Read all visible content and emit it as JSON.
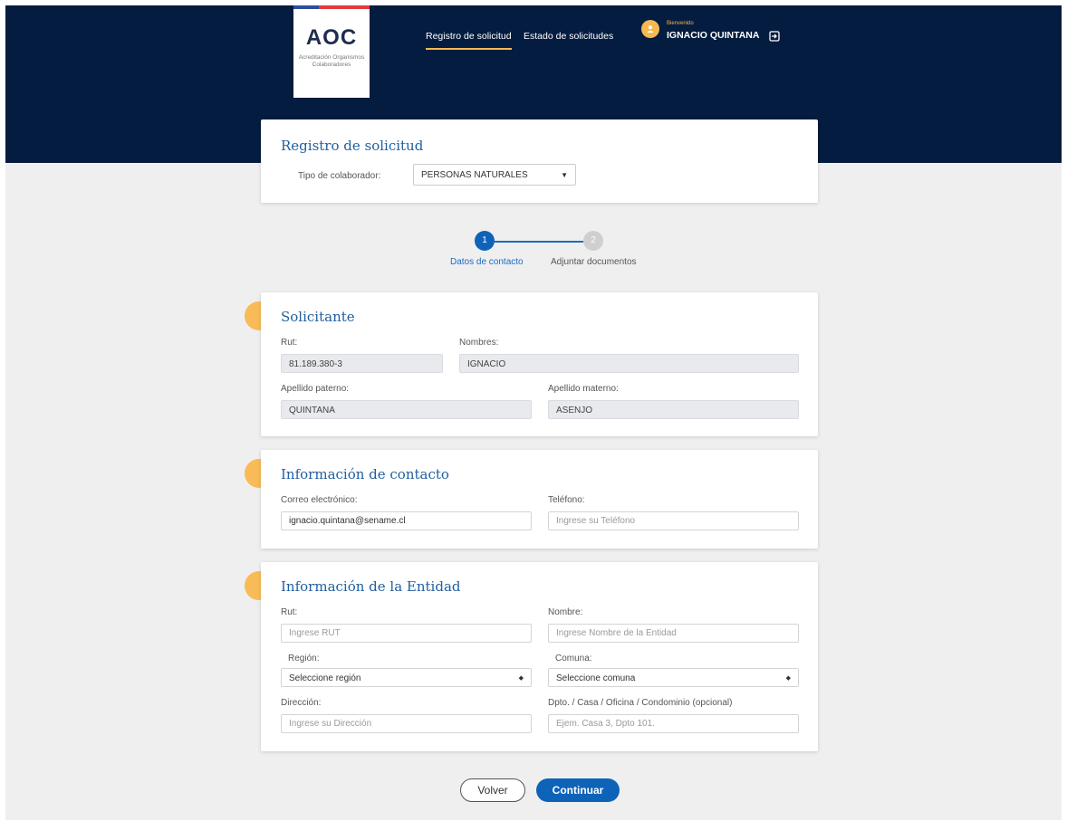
{
  "header": {
    "logo_title": "AOC",
    "logo_subtitle": "Acreditación Organismos Colaboradores",
    "nav": [
      {
        "label": "Registro de solicitud",
        "active": true
      },
      {
        "label": "Estado de solicitudes",
        "active": false
      }
    ],
    "user": {
      "greeting": "Bienvenido",
      "name": "IGNACIO QUINTANA"
    },
    "icons": {
      "avatar": "user-icon",
      "logout": "logout-icon"
    }
  },
  "registro": {
    "title": "Registro de solicitud",
    "tipo_label": "Tipo de colaborador:",
    "tipo_value": "PERSONAS NATURALES"
  },
  "stepper": {
    "steps": [
      {
        "number": "1",
        "label": "Datos de contacto",
        "active": true
      },
      {
        "number": "2",
        "label": "Adjuntar documentos",
        "active": false
      }
    ]
  },
  "solicitante": {
    "title": "Solicitante",
    "rut_label": "Rut:",
    "rut_value": "81.189.380-3",
    "nombres_label": "Nombres:",
    "nombres_value": "IGNACIO",
    "ap_paterno_label": "Apellido paterno:",
    "ap_paterno_value": "QUINTANA",
    "ap_materno_label": "Apellido materno:",
    "ap_materno_value": "ASENJO"
  },
  "contacto": {
    "title": "Información de contacto",
    "correo_label": "Correo electrónico:",
    "correo_value": "ignacio.quintana@sename.cl",
    "telefono_label": "Teléfono:",
    "telefono_placeholder": "Ingrese su Teléfono"
  },
  "entidad": {
    "title": "Información de la Entidad",
    "rut_label": "Rut:",
    "rut_placeholder": "Ingrese RUT",
    "nombre_label": "Nombre:",
    "nombre_placeholder": "Ingrese Nombre de la Entidad",
    "region_label": "Región:",
    "region_value": "Seleccione región",
    "comuna_label": "Comuna:",
    "comuna_value": "Seleccione comuna",
    "direccion_label": "Dirección:",
    "direccion_placeholder": "Ingrese su Dirección",
    "dpto_label": "Dpto. / Casa / Oficina / Condominio (opcional)",
    "dpto_placeholder": "Ejem. Casa 3, Dpto 101."
  },
  "actions": {
    "back_label": "Volver",
    "continue_label": "Continuar"
  },
  "colors": {
    "navy": "#031c40",
    "accent": "#f8bb57",
    "primary": "#0d63b8",
    "title_blue": "#1f5f9e"
  }
}
